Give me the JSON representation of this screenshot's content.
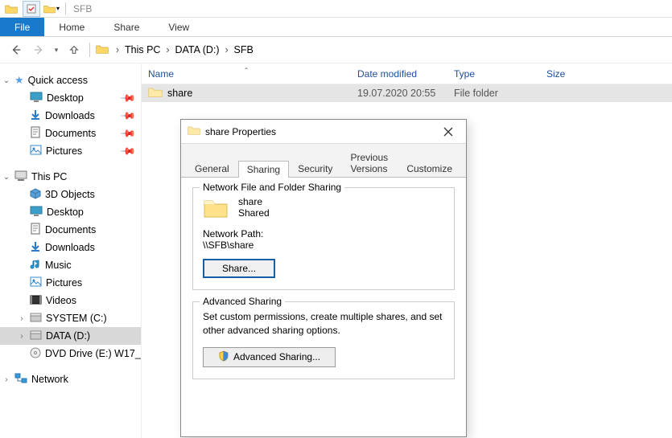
{
  "titlebar": {
    "app_context": "SFB"
  },
  "ribbon": {
    "file": "File",
    "home": "Home",
    "share": "Share",
    "view": "View"
  },
  "breadcrumb": {
    "pc": "This PC",
    "drive": "DATA (D:)",
    "folder": "SFB"
  },
  "columns": {
    "name": "Name",
    "date": "Date modified",
    "type": "Type",
    "size": "Size"
  },
  "rows": [
    {
      "name": "share",
      "date": "19.07.2020 20:55",
      "type": "File folder"
    }
  ],
  "sidebar": {
    "quick": "Quick access",
    "desktop": "Desktop",
    "downloads": "Downloads",
    "documents": "Documents",
    "pictures": "Pictures",
    "thispc": "This PC",
    "objects3d": "3D Objects",
    "desktop2": "Desktop",
    "documents2": "Documents",
    "downloads2": "Downloads",
    "music": "Music",
    "pictures2": "Pictures",
    "videos": "Videos",
    "system": "SYSTEM (C:)",
    "data": "DATA (D:)",
    "dvd": "DVD Drive (E:) W17_",
    "network": "Network"
  },
  "dialog": {
    "title": "share Properties",
    "tabs": {
      "general": "General",
      "sharing": "Sharing",
      "security": "Security",
      "prev": "Previous Versions",
      "custom": "Customize"
    },
    "group1_title": "Network File and Folder Sharing",
    "share_name": "share",
    "share_status": "Shared",
    "net_path_label": "Network Path:",
    "net_path_value": "\\\\SFB\\share",
    "share_btn": "Share...",
    "group2_title": "Advanced Sharing",
    "adv_text": "Set custom permissions, create multiple shares, and set other advanced sharing options.",
    "adv_btn": "Advanced Sharing..."
  }
}
